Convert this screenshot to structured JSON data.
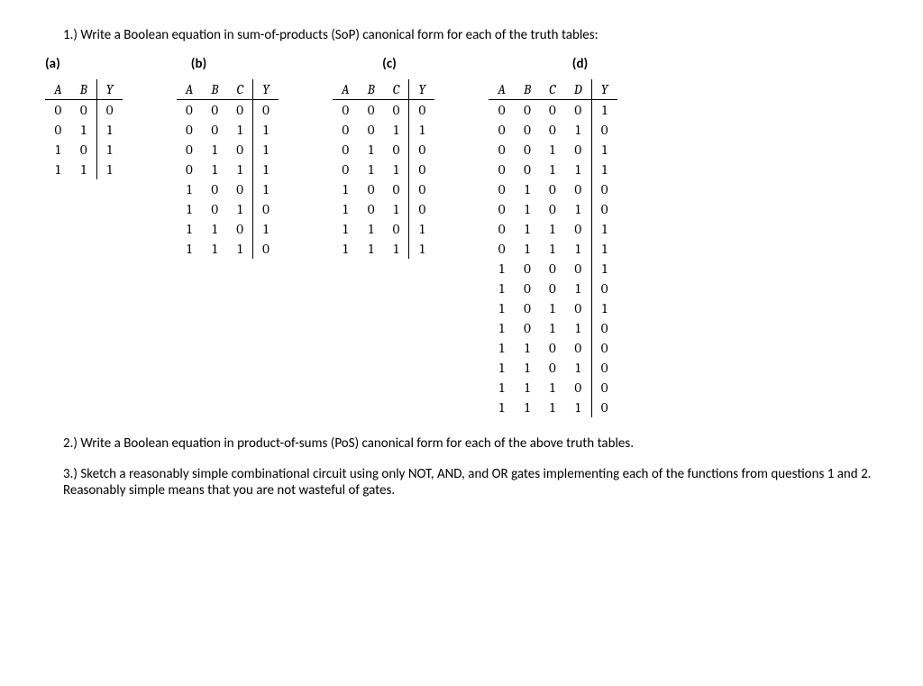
{
  "q1": {
    "number": "1.)",
    "text": "Write a Boolean equation in sum-of-products (SoP) canonical form for each of the truth tables:"
  },
  "parts": {
    "a": "(a)",
    "b": "(b)",
    "c": "(c)",
    "d": "(d)"
  },
  "tables": {
    "a": {
      "headers": [
        "A",
        "B",
        "Y"
      ],
      "rows": [
        [
          "0",
          "0",
          "0"
        ],
        [
          "0",
          "1",
          "1"
        ],
        [
          "1",
          "0",
          "1"
        ],
        [
          "1",
          "1",
          "1"
        ]
      ]
    },
    "b": {
      "headers": [
        "A",
        "B",
        "C",
        "Y"
      ],
      "rows": [
        [
          "0",
          "0",
          "0",
          "0"
        ],
        [
          "0",
          "0",
          "1",
          "1"
        ],
        [
          "0",
          "1",
          "0",
          "1"
        ],
        [
          "0",
          "1",
          "1",
          "1"
        ],
        [
          "1",
          "0",
          "0",
          "1"
        ],
        [
          "1",
          "0",
          "1",
          "0"
        ],
        [
          "1",
          "1",
          "0",
          "1"
        ],
        [
          "1",
          "1",
          "1",
          "0"
        ]
      ]
    },
    "c": {
      "headers": [
        "A",
        "B",
        "C",
        "Y"
      ],
      "rows": [
        [
          "0",
          "0",
          "0",
          "0"
        ],
        [
          "0",
          "0",
          "1",
          "1"
        ],
        [
          "0",
          "1",
          "0",
          "0"
        ],
        [
          "0",
          "1",
          "1",
          "0"
        ],
        [
          "1",
          "0",
          "0",
          "0"
        ],
        [
          "1",
          "0",
          "1",
          "0"
        ],
        [
          "1",
          "1",
          "0",
          "1"
        ],
        [
          "1",
          "1",
          "1",
          "1"
        ]
      ]
    },
    "d": {
      "headers": [
        "A",
        "B",
        "C",
        "D",
        "Y"
      ],
      "rows": [
        [
          "0",
          "0",
          "0",
          "0",
          "1"
        ],
        [
          "0",
          "0",
          "0",
          "1",
          "0"
        ],
        [
          "0",
          "0",
          "1",
          "0",
          "1"
        ],
        [
          "0",
          "0",
          "1",
          "1",
          "1"
        ],
        [
          "0",
          "1",
          "0",
          "0",
          "0"
        ],
        [
          "0",
          "1",
          "0",
          "1",
          "0"
        ],
        [
          "0",
          "1",
          "1",
          "0",
          "1"
        ],
        [
          "0",
          "1",
          "1",
          "1",
          "1"
        ],
        [
          "1",
          "0",
          "0",
          "0",
          "1"
        ],
        [
          "1",
          "0",
          "0",
          "1",
          "0"
        ],
        [
          "1",
          "0",
          "1",
          "0",
          "1"
        ],
        [
          "1",
          "0",
          "1",
          "1",
          "0"
        ],
        [
          "1",
          "1",
          "0",
          "0",
          "0"
        ],
        [
          "1",
          "1",
          "0",
          "1",
          "0"
        ],
        [
          "1",
          "1",
          "1",
          "0",
          "0"
        ],
        [
          "1",
          "1",
          "1",
          "1",
          "0"
        ]
      ]
    }
  },
  "q2": {
    "number": "2.)",
    "text": "Write a Boolean equation in product-of-sums (PoS) canonical form for each of the above truth tables."
  },
  "q3": {
    "number": "3.)",
    "text": "Sketch a reasonably simple combinational circuit using only NOT, AND, and OR gates implementing each of the functions from questions 1 and 2. Reasonably simple means that you are not wasteful of gates."
  }
}
